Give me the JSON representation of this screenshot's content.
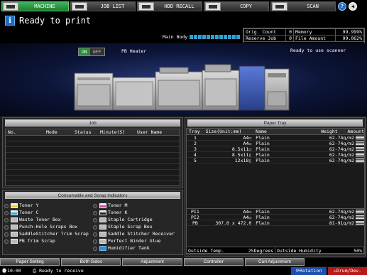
{
  "topbar": {
    "tabs": [
      {
        "label": "MACHINE",
        "icon": "machine-icon",
        "active": true
      },
      {
        "label": "JOB LIST",
        "icon": "job-list-icon",
        "active": false
      },
      {
        "label": "HDD RECALL",
        "icon": "hdd-recall-icon",
        "active": false
      },
      {
        "label": "COPY",
        "icon": "copy-icon",
        "active": false
      },
      {
        "label": "SCAN",
        "icon": "scan-icon",
        "active": false
      }
    ],
    "help_label": "?",
    "accent": "#1f7c33"
  },
  "status": {
    "message": "Ready to print",
    "info_label": "i",
    "main_body_label": "Main Body",
    "counts": {
      "orig_count_label": "Orig. Count",
      "orig_count_value": "0",
      "reserve_job_label": "Reserve Job",
      "reserve_job_value": "0",
      "memory_label": "Memory",
      "memory_value": "99.999%",
      "file_amount_label": "File Amount",
      "file_amount_value": "99.062%"
    }
  },
  "machine": {
    "on_label": "ON",
    "off_label": "OFF",
    "pb_heater_label": "PB Heater",
    "scanner_status": "Ready to use scanner"
  },
  "job": {
    "title": "Job",
    "columns": [
      "No.",
      "Mode",
      "Status",
      "Minute(S)",
      "User Name"
    ]
  },
  "consumables": {
    "title": "Consumable and Scrap Indicators",
    "left": [
      {
        "label": "Toner Y",
        "icon": "toner-y-icon"
      },
      {
        "label": "Toner C",
        "icon": "toner-c-icon"
      },
      {
        "label": "Waste Toner Box",
        "icon": "waste-toner-icon"
      },
      {
        "label": "Punch-Hole Scraps Box",
        "icon": "punch-scrap-icon"
      },
      {
        "label": "SaddleStitcher Trim Scrap",
        "icon": "trim-scrap-icon"
      },
      {
        "label": "PB Trim Scrap",
        "icon": "pb-trim-icon"
      }
    ],
    "right": [
      {
        "label": "Toner M",
        "icon": "toner-m-icon"
      },
      {
        "label": "Toner K",
        "icon": "toner-k-icon"
      },
      {
        "label": "Staple Cartridge",
        "icon": "staple-cartridge-icon"
      },
      {
        "label": "Staple Scrap Box",
        "icon": "staple-scrap-icon"
      },
      {
        "label": "Saddle Stitcher Receiver",
        "icon": "saddle-receiver-icon"
      },
      {
        "label": "Perfect Binder Glue",
        "icon": "binder-glue-icon"
      },
      {
        "label": "Humidifier Tank",
        "icon": "humidifier-icon"
      }
    ]
  },
  "paper_tray": {
    "title": "Paper Tray",
    "columns": {
      "tray": "Tray",
      "size": "Size(Unit:mm)",
      "name": "Name",
      "weight": "Weight",
      "amount": "Amount"
    },
    "rows": [
      {
        "tray": "1",
        "size": "A4▭",
        "name": "Plain",
        "weight": "62-74g/m2"
      },
      {
        "tray": "2",
        "size": "A4▭",
        "name": "Plain",
        "weight": "62-74g/m2"
      },
      {
        "tray": "3",
        "size": "8.5x11▭",
        "name": "Plain",
        "weight": "62-74g/m2"
      },
      {
        "tray": "4",
        "size": "8.5x11▯",
        "name": "Plain",
        "weight": "62-74g/m2"
      },
      {
        "tray": "5",
        "size": "12x18▯",
        "name": "Plain",
        "weight": "62-74g/m2"
      }
    ],
    "lower_rows": [
      {
        "tray": "PI1",
        "size": "A4▭",
        "name": "Plain",
        "weight": "62-74g/m2"
      },
      {
        "tray": "PI2",
        "size": "A4▭",
        "name": "Plain",
        "weight": "62-74g/m2"
      },
      {
        "tray": "PB",
        "size": "307.0 x 472.0",
        "name": "Plain",
        "weight": "81-91g/m2"
      }
    ],
    "outside_temp_label": "Outside Temp.",
    "outside_temp_value": "25Degrees",
    "outside_humidity_label": "Outside Humidity",
    "outside_humidity_value": "50%"
  },
  "bottom_tabs": [
    "Paper Setting",
    "Both Sides",
    "Adjustment",
    "Controller",
    "Curl Adjustment"
  ],
  "footer": {
    "clock": "10:00",
    "status": "Ready to receive",
    "rotation_label": "Rotation",
    "drum_label": "Drum/Dev."
  }
}
